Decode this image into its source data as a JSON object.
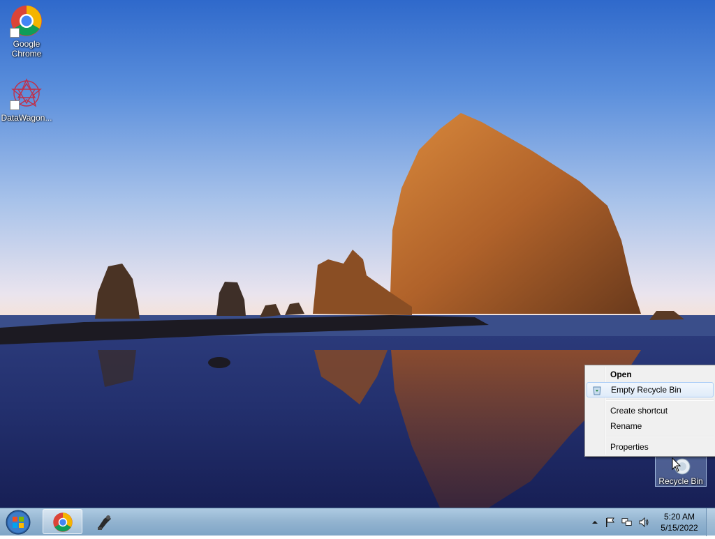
{
  "desktop": {
    "icons": [
      {
        "label": "Google Chrome"
      },
      {
        "label": "DataWagon..."
      },
      {
        "label": "Recycle Bin"
      }
    ]
  },
  "context_menu": {
    "items": [
      {
        "label": "Open",
        "bold": true
      },
      {
        "label": "Empty Recycle Bin",
        "highlighted": true
      },
      {
        "label": "Create shortcut"
      },
      {
        "label": "Rename"
      },
      {
        "label": "Properties"
      }
    ]
  },
  "taskbar": {
    "pinned": [
      {
        "icon": "chrome-icon",
        "active": true
      },
      {
        "icon": "datawagon-icon",
        "active": false
      }
    ],
    "clock": {
      "time": "5:20 AM",
      "date": "5/15/2022"
    },
    "tray_icons": [
      "show-hidden-icons-arrow",
      "action-center-flag-icon",
      "network-icon",
      "volume-icon"
    ]
  },
  "colors": {
    "menu_background": "#f0f0f0",
    "menu_highlight": "#dfebf9",
    "taskbar": "#8cafcd"
  }
}
